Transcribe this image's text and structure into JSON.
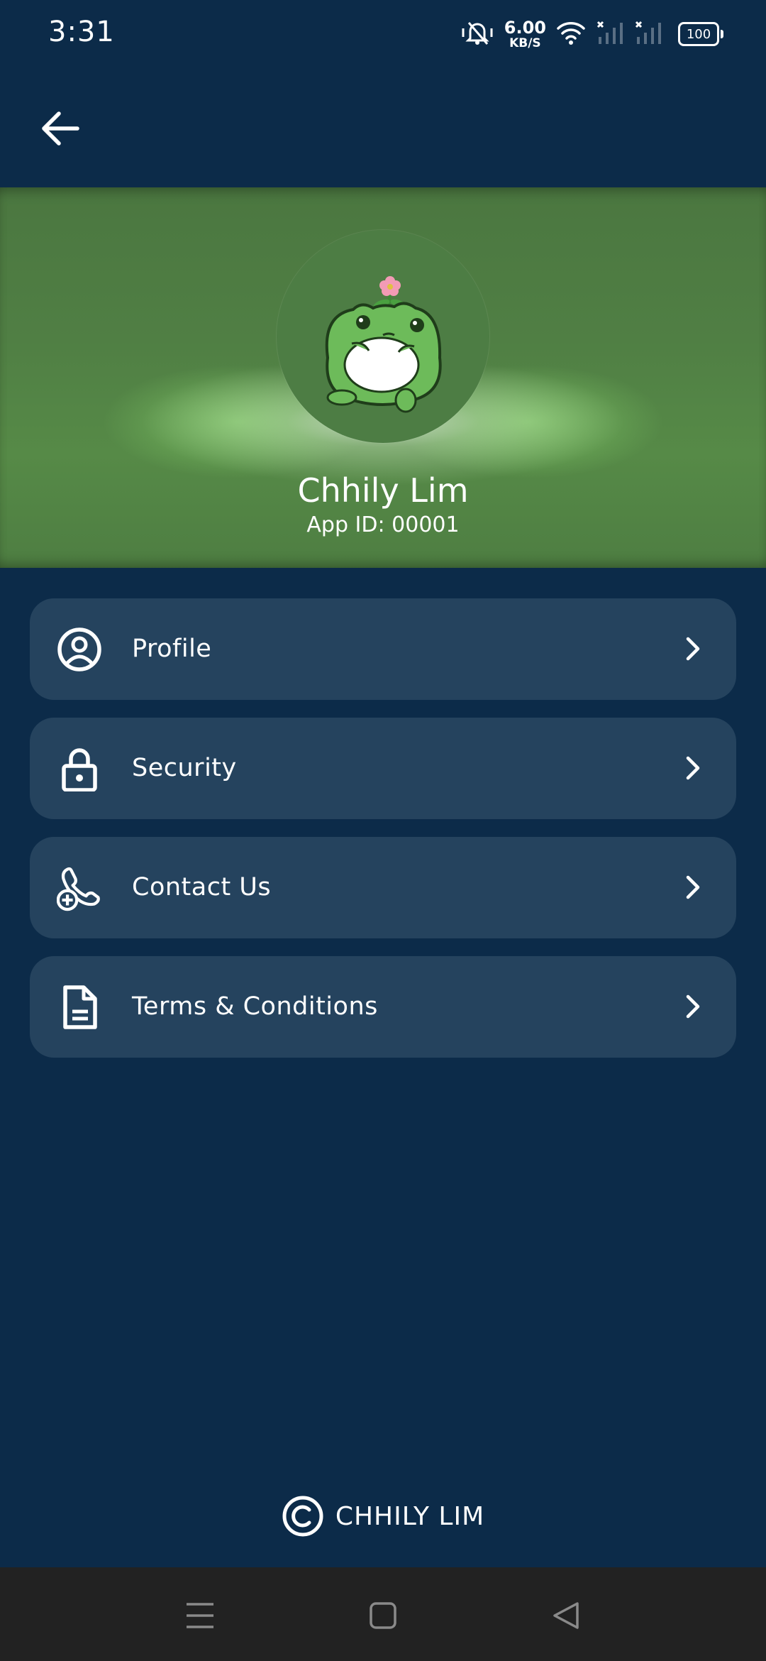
{
  "status_bar": {
    "time": "3:31",
    "net_speed_value": "6.00",
    "net_speed_unit": "KB/S",
    "battery": "100",
    "icons": [
      "vibrate-mute-icon",
      "wifi-icon",
      "signal-no-sim-icon",
      "signal-no-sim-icon",
      "battery-icon"
    ]
  },
  "app_bar": {
    "back_icon": "arrow-left-icon"
  },
  "header": {
    "avatar_icon": "frog-avatar",
    "user_name": "Chhily Lim",
    "app_id": "App ID: 00001"
  },
  "menu": {
    "items": [
      {
        "label": "Profile",
        "icon": "user-circle-icon"
      },
      {
        "label": "Security",
        "icon": "lock-icon"
      },
      {
        "label": "Contact Us",
        "icon": "phone-plus-icon"
      },
      {
        "label": "Terms & Conditions",
        "icon": "document-icon"
      }
    ],
    "chevron_icon": "chevron-right-icon"
  },
  "footer": {
    "icon": "copyright-icon",
    "text": "CHHILY LIM"
  },
  "nav_bar": {
    "buttons": [
      "menu-icon",
      "home-square-icon",
      "back-triangle-icon"
    ]
  },
  "colors": {
    "background": "#0c2b49",
    "card": "#25435e",
    "banner_green": "#507f44",
    "nav_bar": "#222222",
    "text": "#ffffff"
  }
}
